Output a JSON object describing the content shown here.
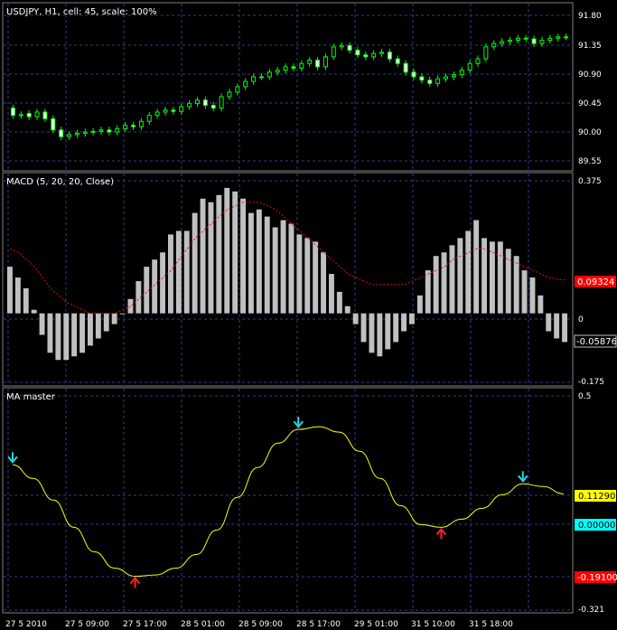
{
  "panels": {
    "price": {
      "title": "USDJPY, H1, cell: 45, scale: 100%",
      "y_ticks": [
        "91.80",
        "91.35",
        "90.90",
        "90.45",
        "90.00",
        "89.55"
      ]
    },
    "macd": {
      "title": "MACD (5, 20, 20, Close)",
      "y_ticks": [
        "0.375",
        "0",
        "-0.175"
      ],
      "signal_tag": "0.09324",
      "hist_tag": "-0.05876"
    },
    "ma": {
      "title": "MA master",
      "y_ticks": [
        "0.5",
        "-0.321"
      ],
      "line_tag": "0.11290",
      "zero_tag": "0.00000",
      "low_tag": "-0.19100"
    }
  },
  "x_labels": [
    "27 5 2010",
    "27 5 09:00",
    "27 5 17:00",
    "28 5 01:00",
    "28 5 09:00",
    "28 5 17:00",
    "29 5 01:00",
    "31 5 10:00",
    "31 5 18:00"
  ],
  "colors": {
    "background": "#000000",
    "grid": "#2b3f8a",
    "candle_up": "#00ff00",
    "candle_down_body": "#ffffff",
    "macd_hist": "#c0c0c0",
    "macd_signal": "#e01010",
    "ma_line": "#ffff00",
    "arrow_down": "#22d4e6",
    "arrow_up": "#ff2020",
    "tag_signal": "#ff0000",
    "tag_hist": "#000000",
    "tag_ma": "#ffff00",
    "tag_zero": "#00ffff",
    "tag_low": "#ff0000"
  },
  "chart_data": [
    {
      "type": "candlestick",
      "title": "USDJPY, H1, cell: 45, scale: 100%",
      "ylim": [
        89.45,
        91.95
      ],
      "bar_count": 70,
      "close": [
        90.27,
        90.28,
        90.25,
        90.32,
        90.22,
        90.05,
        89.95,
        89.98,
        90.0,
        90.02,
        90.03,
        90.05,
        90.02,
        90.07,
        90.12,
        90.1,
        90.18,
        90.27,
        90.32,
        90.35,
        90.33,
        90.4,
        90.45,
        90.5,
        90.42,
        90.38,
        90.55,
        90.62,
        90.7,
        90.78,
        90.85,
        90.85,
        90.92,
        90.95,
        91.0,
        90.98,
        91.05,
        91.1,
        91.0,
        91.15,
        91.3,
        91.32,
        91.25,
        91.18,
        91.15,
        91.2,
        91.22,
        91.12,
        91.05,
        90.92,
        90.85,
        90.8,
        90.75,
        90.82,
        90.85,
        90.88,
        90.95,
        91.05,
        91.12,
        91.3,
        91.35,
        91.38,
        91.4,
        91.43,
        91.42,
        91.35,
        91.4,
        91.43,
        91.45,
        91.45
      ],
      "open": [
        90.38,
        90.27,
        90.3,
        90.25,
        90.32,
        90.22,
        90.05,
        89.95,
        89.98,
        90.0,
        90.02,
        90.03,
        90.05,
        90.02,
        90.07,
        90.12,
        90.1,
        90.18,
        90.27,
        90.32,
        90.35,
        90.33,
        90.4,
        90.45,
        90.5,
        90.42,
        90.38,
        90.55,
        90.62,
        90.7,
        90.78,
        90.85,
        90.85,
        90.92,
        90.95,
        91.0,
        90.98,
        91.05,
        91.1,
        91.0,
        91.15,
        91.3,
        91.32,
        91.25,
        91.18,
        91.15,
        91.2,
        91.22,
        91.12,
        91.05,
        90.92,
        90.85,
        90.8,
        90.75,
        90.82,
        90.85,
        90.88,
        90.95,
        91.05,
        91.12,
        91.3,
        91.35,
        91.38,
        91.4,
        91.43,
        91.42,
        91.35,
        91.4,
        91.43,
        91.45
      ]
    },
    {
      "type": "bar",
      "title": "MACD (5, 20, 20, Close)",
      "ylim": [
        -0.2,
        0.39
      ],
      "hist": [
        0.13,
        0.1,
        0.07,
        0.01,
        -0.06,
        -0.11,
        -0.13,
        -0.13,
        -0.12,
        -0.11,
        -0.09,
        -0.07,
        -0.05,
        -0.03,
        0.0,
        0.04,
        0.09,
        0.13,
        0.15,
        0.17,
        0.22,
        0.23,
        0.23,
        0.28,
        0.32,
        0.31,
        0.33,
        0.35,
        0.34,
        0.32,
        0.28,
        0.29,
        0.27,
        0.24,
        0.26,
        0.25,
        0.22,
        0.21,
        0.2,
        0.17,
        0.11,
        0.06,
        0.02,
        -0.03,
        -0.08,
        -0.11,
        -0.12,
        -0.1,
        -0.08,
        -0.05,
        -0.03,
        0.05,
        0.12,
        0.16,
        0.17,
        0.19,
        0.21,
        0.23,
        0.26,
        0.21,
        0.2,
        0.2,
        0.18,
        0.16,
        0.12,
        0.1,
        0.05,
        -0.05,
        -0.07,
        -0.08
      ],
      "signal": [
        0.18,
        0.17,
        0.15,
        0.13,
        0.1,
        0.07,
        0.05,
        0.03,
        0.02,
        0.01,
        0.0,
        0.0,
        0.0,
        0.0,
        0.01,
        0.02,
        0.04,
        0.06,
        0.08,
        0.1,
        0.12,
        0.15,
        0.18,
        0.21,
        0.23,
        0.25,
        0.27,
        0.29,
        0.3,
        0.31,
        0.31,
        0.31,
        0.3,
        0.29,
        0.27,
        0.25,
        0.23,
        0.21,
        0.19,
        0.17,
        0.15,
        0.13,
        0.11,
        0.1,
        0.09,
        0.08,
        0.08,
        0.08,
        0.08,
        0.08,
        0.09,
        0.1,
        0.11,
        0.12,
        0.13,
        0.15,
        0.16,
        0.17,
        0.18,
        0.18,
        0.17,
        0.16,
        0.15,
        0.14,
        0.13,
        0.12,
        0.11,
        0.1,
        0.095,
        0.093
      ]
    },
    {
      "type": "line",
      "title": "MA master",
      "ylim": [
        -0.321,
        0.5
      ],
      "values": [
        0.22,
        0.17,
        0.09,
        -0.01,
        -0.1,
        -0.16,
        -0.19,
        -0.185,
        -0.16,
        -0.11,
        -0.02,
        0.1,
        0.21,
        0.3,
        0.35,
        0.36,
        0.34,
        0.27,
        0.17,
        0.07,
        0.0,
        -0.01,
        0.02,
        0.06,
        0.11,
        0.15,
        0.14,
        0.113
      ],
      "arrows_down_at": [
        0,
        14,
        25
      ],
      "arrows_up_at": [
        6,
        21
      ]
    }
  ]
}
